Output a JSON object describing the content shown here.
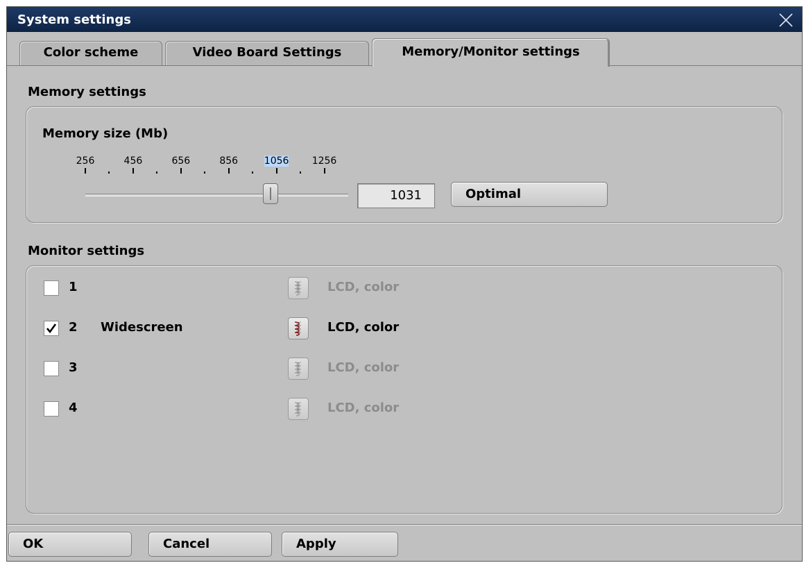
{
  "window": {
    "title": "System settings"
  },
  "tabs": [
    {
      "label": "Color scheme",
      "active": false
    },
    {
      "label": "Video Board Settings",
      "active": false
    },
    {
      "label": "Memory/Monitor settings",
      "active": true
    }
  ],
  "memory": {
    "section_title": "Memory settings",
    "slider_label": "Memory size (Mb)",
    "tick_labels": [
      "256",
      "456",
      "656",
      "856",
      "1056",
      "1256"
    ],
    "highlighted_tick": "1056",
    "range": [
      256,
      1356
    ],
    "value": 1031,
    "value_text": "1031",
    "optimal_label": "Optimal"
  },
  "monitors": {
    "section_title": "Monitor settings",
    "items": [
      {
        "number": "1",
        "name": "",
        "checked": false,
        "type": "LCD, color",
        "enabled": false
      },
      {
        "number": "2",
        "name": "Widescreen",
        "checked": true,
        "type": "LCD, color",
        "enabled": true
      },
      {
        "number": "3",
        "name": "",
        "checked": false,
        "type": "LCD, color",
        "enabled": false
      },
      {
        "number": "4",
        "name": "",
        "checked": false,
        "type": "LCD, color",
        "enabled": false
      }
    ]
  },
  "footer": {
    "ok_label": "OK",
    "cancel_label": "Cancel",
    "apply_label": "Apply"
  },
  "icons": {
    "close": "close-icon",
    "monitor": "monitor-icon",
    "check": "checkmark-icon"
  },
  "colors": {
    "titlebar": "#13294d",
    "window_bg": "#c0c0c0",
    "disabled_text": "#8c8c8c",
    "tick_highlight": "#b9d8ff",
    "monitor_icon_active": "#8b1a1a"
  }
}
